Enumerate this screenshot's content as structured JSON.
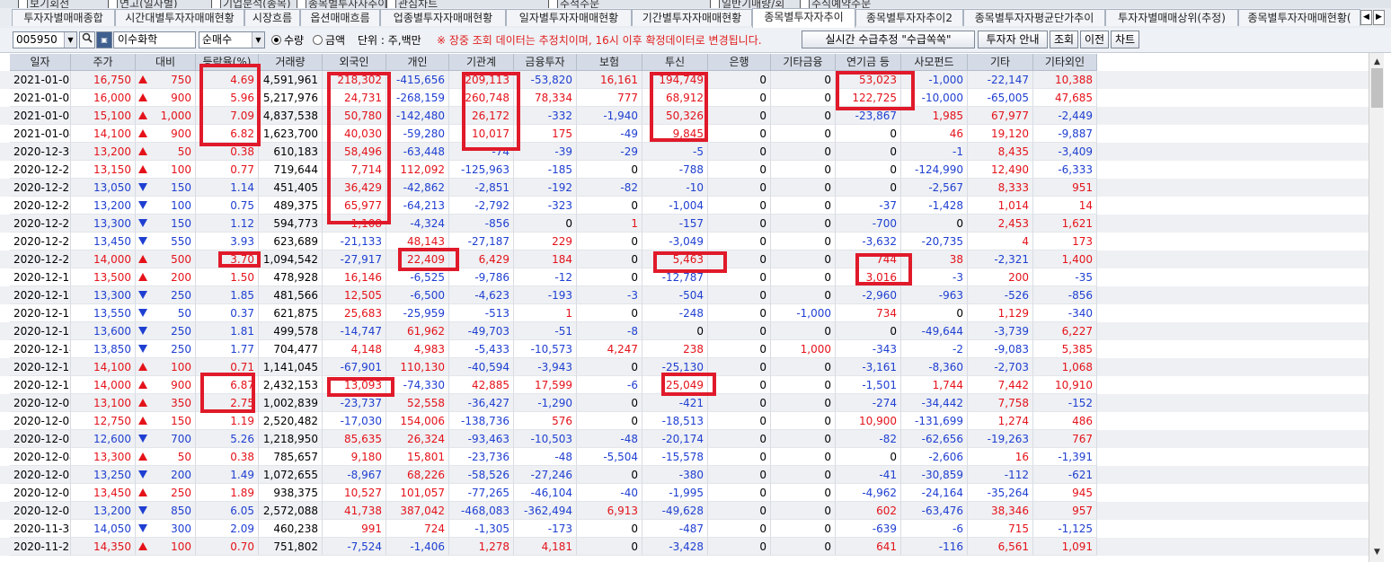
{
  "top_strip": [
    "보기회전",
    "연고(일자별)",
    "기업분석(종목)",
    "종목별투자자추이",
    "관심차트",
    "추적주문",
    "일반기매량/회",
    "주식예약주문"
  ],
  "tabs": [
    {
      "label": "투자자별매매종합",
      "active": false
    },
    {
      "label": "시간대별투자자매매현황",
      "active": false
    },
    {
      "label": "시장흐름",
      "active": false
    },
    {
      "label": "옵션매매흐름",
      "active": false
    },
    {
      "label": "업종별투자자매매현황",
      "active": false
    },
    {
      "label": "일자별투자자매매현황",
      "active": false
    },
    {
      "label": "기간별투자자매매현황",
      "active": false
    },
    {
      "label": "종목별투자자추이",
      "active": true
    },
    {
      "label": "종목별투자자추이2",
      "active": false
    },
    {
      "label": "종목별투자자평균단가추이",
      "active": false
    },
    {
      "label": "투자자별매매상위(추정)",
      "active": false
    },
    {
      "label": "종목별투자자매매현황(",
      "active": false
    }
  ],
  "tab_nav": {
    "prev": "◀",
    "next": "▶"
  },
  "toolbar": {
    "code_value": "005950",
    "search_icon": "magnifier-icon",
    "name_value": "이수화학",
    "sort_value": "순매수",
    "radio_qty": "수량",
    "radio_amount": "금액",
    "radio_selected": "qty",
    "unit_text": "단위 : 주,백만",
    "notice": "※ 장중 조회 데이터는 추정치이며, 16시 이후 확정데이터로 변경됩니다.",
    "btn_realtime": "실시간 수급추정 \"수급쏙쏙\"",
    "btn_investor_info": "투자자 안내",
    "btn_query": "조회",
    "btn_prev": "이전",
    "btn_chart": "차트"
  },
  "columns": [
    "일자",
    "주가",
    "대비",
    "등락율(%)",
    "거래량",
    "외국인",
    "개인",
    "기관계",
    "금융투자",
    "보험",
    "투신",
    "은행",
    "기타금융",
    "연기금 등",
    "사모펀드",
    "기타",
    "기타외인"
  ],
  "rows": [
    [
      "2021-01-07",
      "16,750",
      "up",
      "750",
      "4.69",
      "4,591,961",
      "218,302",
      "-415,656",
      "209,113",
      "-53,820",
      "16,161",
      "194,749",
      "0",
      "0",
      "53,023",
      "-1,000",
      "-22,147",
      "10,388"
    ],
    [
      "2021-01-06",
      "16,000",
      "up",
      "900",
      "5.96",
      "5,217,976",
      "24,731",
      "-268,159",
      "260,748",
      "78,334",
      "777",
      "68,912",
      "0",
      "0",
      "122,725",
      "-10,000",
      "-65,005",
      "47,685"
    ],
    [
      "2021-01-05",
      "15,100",
      "up",
      "1,000",
      "7.09",
      "4,837,538",
      "50,780",
      "-142,480",
      "26,172",
      "-332",
      "-1,940",
      "50,326",
      "0",
      "0",
      "-23,867",
      "1,985",
      "67,977",
      "-2,449"
    ],
    [
      "2021-01-04",
      "14,100",
      "up",
      "900",
      "6.82",
      "1,623,700",
      "40,030",
      "-59,280",
      "10,017",
      "175",
      "-49",
      "9,845",
      "0",
      "0",
      "0",
      "46",
      "19,120",
      "-9,887"
    ],
    [
      "2020-12-30",
      "13,200",
      "up",
      "50",
      "0.38",
      "610,183",
      "58,496",
      "-63,448",
      "-74",
      "-39",
      "-29",
      "-5",
      "0",
      "0",
      "0",
      "-1",
      "8,435",
      "-3,409"
    ],
    [
      "2020-12-29",
      "13,150",
      "up",
      "100",
      "0.77",
      "719,644",
      "7,714",
      "112,092",
      "-125,963",
      "-185",
      "0",
      "-788",
      "0",
      "0",
      "0",
      "-124,990",
      "12,490",
      "-6,333"
    ],
    [
      "2020-12-28",
      "13,050",
      "dn",
      "150",
      "1.14",
      "451,405",
      "36,429",
      "-42,862",
      "-2,851",
      "-192",
      "-82",
      "-10",
      "0",
      "0",
      "0",
      "-2,567",
      "8,333",
      "951"
    ],
    [
      "2020-12-24",
      "13,200",
      "dn",
      "100",
      "0.75",
      "489,375",
      "65,977",
      "-64,213",
      "-2,792",
      "-323",
      "0",
      "-1,004",
      "0",
      "0",
      "-37",
      "-1,428",
      "1,014",
      "14"
    ],
    [
      "2020-12-23",
      "13,300",
      "dn",
      "150",
      "1.12",
      "594,773",
      "1,108",
      "-4,324",
      "-856",
      "0",
      "1",
      "-157",
      "0",
      "0",
      "-700",
      "0",
      "2,453",
      "1,621"
    ],
    [
      "2020-12-22",
      "13,450",
      "dn",
      "550",
      "3.93",
      "623,689",
      "-21,133",
      "48,143",
      "-27,187",
      "229",
      "0",
      "-3,049",
      "0",
      "0",
      "-3,632",
      "-20,735",
      "4",
      "173"
    ],
    [
      "2020-12-21",
      "14,000",
      "up",
      "500",
      "3.70",
      "1,094,542",
      "-27,917",
      "22,409",
      "6,429",
      "184",
      "0",
      "5,463",
      "0",
      "0",
      "744",
      "38",
      "-2,321",
      "1,400"
    ],
    [
      "2020-12-18",
      "13,500",
      "up",
      "200",
      "1.50",
      "478,928",
      "16,146",
      "-6,525",
      "-9,786",
      "-12",
      "0",
      "-12,787",
      "0",
      "0",
      "3,016",
      "-3",
      "200",
      "-35"
    ],
    [
      "2020-12-17",
      "13,300",
      "dn",
      "250",
      "1.85",
      "481,566",
      "12,505",
      "-6,500",
      "-4,623",
      "-193",
      "-3",
      "-504",
      "0",
      "0",
      "-2,960",
      "-963",
      "-526",
      "-856"
    ],
    [
      "2020-12-16",
      "13,550",
      "dn",
      "50",
      "0.37",
      "621,875",
      "25,683",
      "-25,959",
      "-513",
      "1",
      "0",
      "-248",
      "0",
      "-1,000",
      "734",
      "0",
      "1,129",
      "-340"
    ],
    [
      "2020-12-15",
      "13,600",
      "dn",
      "250",
      "1.81",
      "499,578",
      "-14,747",
      "61,962",
      "-49,703",
      "-51",
      "-8",
      "0",
      "0",
      "0",
      "0",
      "-49,644",
      "-3,739",
      "6,227"
    ],
    [
      "2020-12-14",
      "13,850",
      "dn",
      "250",
      "1.77",
      "704,477",
      "4,148",
      "4,983",
      "-5,433",
      "-10,573",
      "4,247",
      "238",
      "0",
      "1,000",
      "-343",
      "-2",
      "-9,083",
      "5,385"
    ],
    [
      "2020-12-11",
      "14,100",
      "up",
      "100",
      "0.71",
      "1,141,045",
      "-67,901",
      "110,130",
      "-40,594",
      "-3,943",
      "0",
      "-25,130",
      "0",
      "0",
      "-3,161",
      "-8,360",
      "-2,703",
      "1,068"
    ],
    [
      "2020-12-10",
      "14,000",
      "up",
      "900",
      "6.87",
      "2,432,153",
      "13,093",
      "-74,330",
      "42,885",
      "17,599",
      "-6",
      "25,049",
      "0",
      "0",
      "-1,501",
      "1,744",
      "7,442",
      "10,910"
    ],
    [
      "2020-12-09",
      "13,100",
      "up",
      "350",
      "2.75",
      "1,002,839",
      "-23,737",
      "52,558",
      "-36,427",
      "-1,290",
      "0",
      "-421",
      "0",
      "0",
      "-274",
      "-34,442",
      "7,758",
      "-152"
    ],
    [
      "2020-12-08",
      "12,750",
      "up",
      "150",
      "1.19",
      "2,520,482",
      "-17,030",
      "154,006",
      "-138,736",
      "576",
      "0",
      "-18,513",
      "0",
      "0",
      "10,900",
      "-131,699",
      "1,274",
      "486"
    ],
    [
      "2020-12-07",
      "12,600",
      "dn",
      "700",
      "5.26",
      "1,218,950",
      "85,635",
      "26,324",
      "-93,463",
      "-10,503",
      "-48",
      "-20,174",
      "0",
      "0",
      "-82",
      "-62,656",
      "-19,263",
      "767"
    ],
    [
      "2020-12-04",
      "13,300",
      "up",
      "50",
      "0.38",
      "785,657",
      "9,180",
      "15,801",
      "-23,736",
      "-48",
      "-5,504",
      "-15,578",
      "0",
      "0",
      "0",
      "-2,606",
      "16",
      "-1,391"
    ],
    [
      "2020-12-03",
      "13,250",
      "dn",
      "200",
      "1.49",
      "1,072,655",
      "-8,967",
      "68,226",
      "-58,526",
      "-27,246",
      "0",
      "-380",
      "0",
      "0",
      "-41",
      "-30,859",
      "-112",
      "-621"
    ],
    [
      "2020-12-02",
      "13,450",
      "up",
      "250",
      "1.89",
      "938,375",
      "10,527",
      "101,057",
      "-77,265",
      "-46,104",
      "-40",
      "-1,995",
      "0",
      "0",
      "-4,962",
      "-24,164",
      "-35,264",
      "945"
    ],
    [
      "2020-12-01",
      "13,200",
      "dn",
      "850",
      "6.05",
      "2,572,088",
      "41,738",
      "387,042",
      "-468,083",
      "-362,494",
      "6,913",
      "-49,628",
      "0",
      "0",
      "602",
      "-63,476",
      "38,346",
      "957"
    ],
    [
      "2020-11-30",
      "14,050",
      "dn",
      "300",
      "2.09",
      "460,238",
      "991",
      "724",
      "-1,305",
      "-173",
      "0",
      "-487",
      "0",
      "0",
      "-639",
      "-6",
      "715",
      "-1,125"
    ],
    [
      "2020-11-27",
      "14,350",
      "up",
      "100",
      "0.70",
      "751,802",
      "-7,524",
      "-1,406",
      "1,278",
      "4,181",
      "0",
      "-3,428",
      "0",
      "0",
      "641",
      "-116",
      "6,561",
      "1,091"
    ]
  ],
  "colors": {
    "up": "#e4121a",
    "down": "#1f3fd1",
    "highlight": "#e01a2a",
    "header_bg": "#d4dbe6"
  },
  "scroll_icons": {
    "up": "▲",
    "down": "▼"
  }
}
